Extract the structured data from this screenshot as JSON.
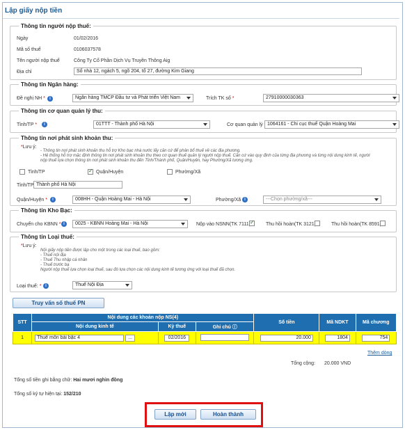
{
  "page_title": "Lập giấy nộp tiền",
  "taxpayer": {
    "legend": "Thông tin người nộp thuế:",
    "date_label": "Ngày",
    "date_value": "01/02/2016",
    "tax_code_label": "Mã số thuế",
    "tax_code_value": "0106037578",
    "name_label": "Tên người nộp thuế",
    "name_value": "Công Ty Cổ Phần Dịch Vụ Truyền Thông Aig",
    "address_label": "Địa chỉ",
    "address_value": "Số nhà 12, ngách 5, ngõ 204, tổ 27, đường Kim Giang"
  },
  "bank": {
    "legend": "Thông tin Ngân hàng:",
    "request_label": "Đề nghị NH",
    "request_value": "Ngân hàng TMCP Đầu tư và Phát triển Việt Nam",
    "account_label": "Trích TK số",
    "account_value": "27910000030363"
  },
  "agency": {
    "legend": "Thông tin cơ quan quản lý thu:",
    "province_label": "Tỉnh/TP",
    "province_value": "01TTT - Thành phố Hà Nội",
    "agency_label": "Cơ quan quản lý thu",
    "agency_value": "1064161 - Chi cục thuế Quận Hoàng Mai"
  },
  "origin": {
    "legend": "Thông tin nơi phát sinh khoản thu:",
    "note_title": "Lưu ý:",
    "note_lines": [
      "- Thông tin nơi phát sinh khoản thu hỗ trợ Kho bạc nhà nước lấy căn cứ để phân bổ thuế về các địa phương.",
      "- Hệ thống hỗ trợ mặc định thông tin nơi phát sinh khoản thu theo cơ quan thuế quản lý người nộp thuế. Căn cứ vào quy định của từng địa phương và từng nội dung kinh tế, người",
      "nộp thuế lựa chọn thông tin nơi phát sinh khoản thu đến Tỉnh/Thành phố, Quận/Huyện, hay Phường/Xã tương ứng."
    ],
    "cb_province": "Tỉnh/TP",
    "cb_district": "Quận/Huyện",
    "cb_ward": "Phường/Xã",
    "province_label": "Tỉnh/TP:",
    "province_value": "Thành phố Hà Nội",
    "district_label": "Quận/Huyện",
    "district_value": "008HH - Quận Hoàng Mai - Hà Nội",
    "ward_label": "Phường/Xã",
    "ward_value": "---Chọn phường/xã---"
  },
  "treasury": {
    "legend": "Thông tin Kho Bạc:",
    "transfer_label": "Chuyển cho KBNN",
    "transfer_value": "0025 - KBNN Hoàng Mai - Hà Nội",
    "nsnn_label": "Nộp vào NSNN(TK 7111):",
    "refund1_label": "Thu hồi hoàn(TK 3121):",
    "refund2_label": "Thu hồi hoàn(TK 8591):"
  },
  "taxtype": {
    "legend": "Thông tin Loại thuế:",
    "note_title": "Lưu ý:",
    "note_lines": [
      "Nội giấy nộp tiền được lập cho một trong các loại thuế, bao gồm:",
      "- Thuế nội địa",
      "- Thuế Thu nhập cá nhân",
      "- Thuế trước bạ",
      "Người nộp thuế lựa chọn loại thuế, sau đó lựa chọn các nội dung kinh tế tương ứng với loại thuế đã chọn."
    ],
    "type_label": "Loại thuế:",
    "type_value": "Thuế Nội Địa"
  },
  "query_button": "Truy vấn số thuế PN",
  "table": {
    "col_stt": "STT",
    "group_header": "Nội dung các khoản nộp NS(4)",
    "col_content": "Nội dung kinh tế",
    "col_period": "Kỳ thuế",
    "col_note": "Ghi chú",
    "col_amount": "Số tiền",
    "col_ndkt": "Mã NDKT",
    "col_chapter": "Mã chương",
    "rows": [
      {
        "stt": "1",
        "content": "Thuế môn bài bậc 4",
        "browse": "...",
        "period": "02/2016",
        "note": "",
        "amount": "20.000",
        "ndkt": "1804",
        "chapter": "754"
      }
    ]
  },
  "add_row": "Thêm dòng",
  "total_label": "Tổng cộng:",
  "total_value": "20.000 VND",
  "amount_words_label": "Tổng số tiền ghi bằng chữ:",
  "amount_words_value": "Hai mươi nghìn đồng",
  "char_count_label": "Tổng số ký tự hiện tại:",
  "char_count_value": "152/210",
  "btn_new": "Lập mới",
  "btn_finish": "Hoàn thành"
}
